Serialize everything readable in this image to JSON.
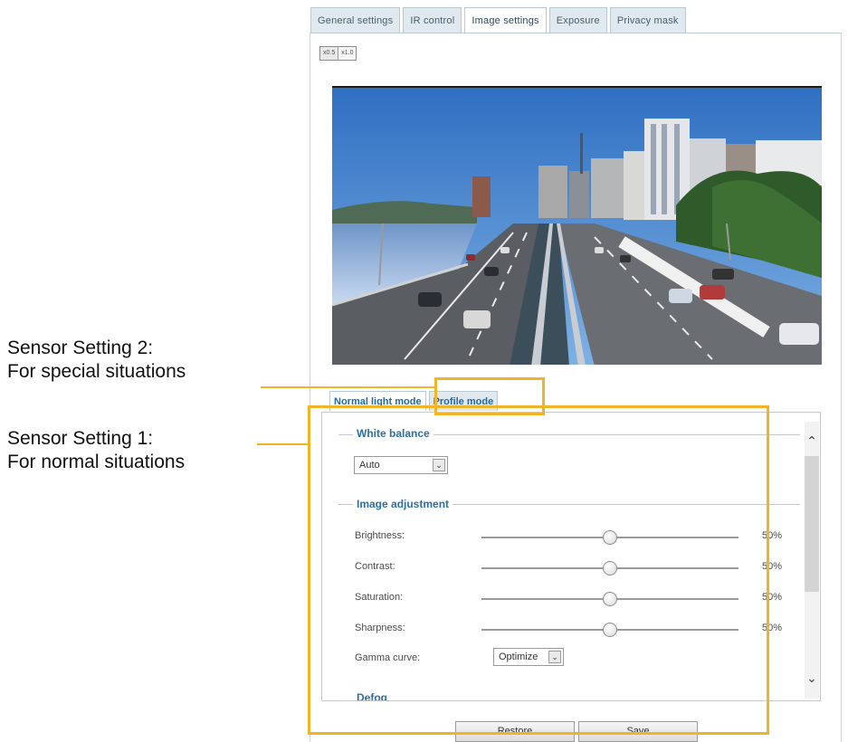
{
  "tabs": [
    {
      "label": "General settings"
    },
    {
      "label": "IR control"
    },
    {
      "label": "Image settings"
    },
    {
      "label": "Exposure"
    },
    {
      "label": "Privacy mask"
    }
  ],
  "zoom_buttons": [
    "x0.5",
    "x1.0"
  ],
  "mode_tabs": [
    {
      "label": "Normal light mode"
    },
    {
      "label": "Profile mode"
    }
  ],
  "white_balance": {
    "legend": "White balance",
    "selected": "Auto"
  },
  "image_adjustment": {
    "legend": "Image adjustment",
    "rows": [
      {
        "label": "Brightness:",
        "value_text": "50%",
        "level": 0.5
      },
      {
        "label": "Contrast:",
        "value_text": "50%",
        "level": 0.5
      },
      {
        "label": "Saturation:",
        "value_text": "50%",
        "level": 0.5
      },
      {
        "label": "Sharpness:",
        "value_text": "50%",
        "level": 0.5
      }
    ],
    "gamma": {
      "label": "Gamma curve:",
      "selected": "Optimize"
    }
  },
  "next_section_legend": "Defog",
  "buttons": {
    "restore": "Restore",
    "save": "Save"
  },
  "annotations": {
    "sensor2": {
      "line1": "Sensor Setting 2:",
      "line2": "For special situations"
    },
    "sensor1": {
      "line1": "Sensor Setting 1:",
      "line2": "For normal situations"
    }
  },
  "colors": {
    "highlight": "#f0b429",
    "tab_text": "#1f6aa8"
  }
}
